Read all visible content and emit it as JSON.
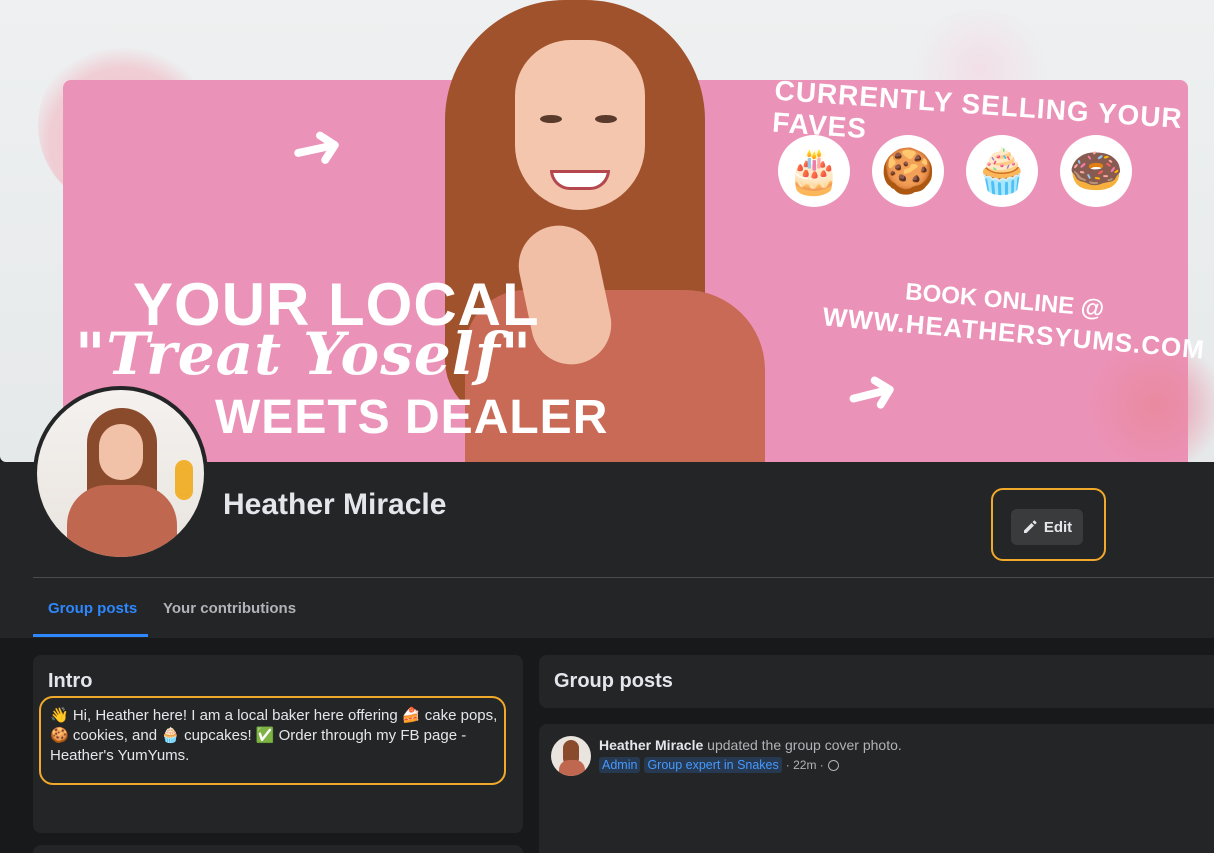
{
  "cover": {
    "tagline_1": "YOUR LOCAL",
    "tagline_2": "\"Treat Yoself\"",
    "tagline_3": "WEETS DEALER",
    "selling": "CURRENTLY SELLING YOUR FAVES",
    "treat_icons": [
      "🎂",
      "🍪",
      "🧁",
      "🍩"
    ],
    "book": "BOOK ONLINE @",
    "website": "WWW.HEATHERSYUMS.COM"
  },
  "profile": {
    "name": "Heather Miracle",
    "edit_label": "Edit"
  },
  "tabs": [
    {
      "label": "Group posts",
      "active": true
    },
    {
      "label": "Your contributions",
      "active": false
    }
  ],
  "intro": {
    "title": "Intro",
    "text": "👋 Hi, Heather here! I am a local baker here offering 🍰 cake pops, 🍪 cookies, and 🧁 cupcakes! ✅ Order through my FB page - Heather's YumYums."
  },
  "group_posts": {
    "title": "Group posts",
    "post": {
      "author": "Heather Miracle",
      "action": " updated the group cover photo.",
      "badges": [
        "Admin",
        "Group expert in Snakes"
      ],
      "time": "· 22m ·"
    }
  },
  "colors": {
    "accent": "#2d88ff",
    "highlight": "#f0a92a",
    "cover_pink": "#eb92b8",
    "background": "#18191a",
    "card": "#242526"
  }
}
